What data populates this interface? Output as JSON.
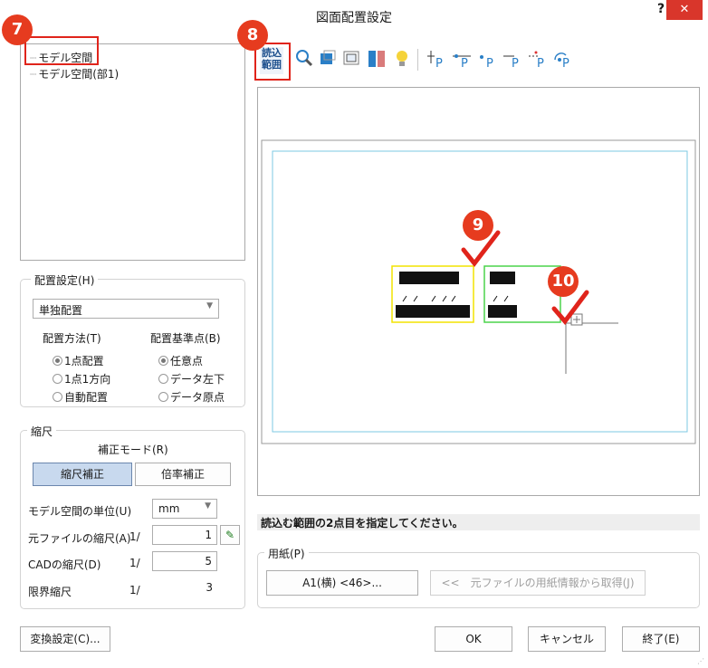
{
  "window": {
    "title": "図面配置設定",
    "help": "?",
    "close": "✕"
  },
  "tree": {
    "items": [
      "モデル空間",
      "モデル空間(部1)"
    ]
  },
  "placement": {
    "group_label": "配置設定(H)",
    "mode_value": "単独配置",
    "method_label": "配置方法(T)",
    "method_options": [
      "1点配置",
      "1点1方向",
      "自動配置"
    ],
    "method_selected": 0,
    "base_label": "配置基準点(B)",
    "base_options": [
      "任意点",
      "データ左下",
      "データ原点"
    ],
    "base_selected": 0
  },
  "scale": {
    "group_label": "縮尺",
    "mode_label": "補正モード(R)",
    "btn_scale": "縮尺補正",
    "btn_ratio": "倍率補正",
    "unit_label": "モデル空間の単位(U)",
    "unit_value": "mm",
    "src_label": "元ファイルの縮尺(A)",
    "src_prefix": "1/",
    "src_value": "1",
    "cad_label": "CADの縮尺(D)",
    "cad_prefix": "1/",
    "cad_value": "5",
    "limit_label": "限界縮尺",
    "limit_prefix": "1/",
    "limit_value": "3"
  },
  "toolbar": {
    "icons": [
      "read-range-icon",
      "zoom-icon",
      "move-icon",
      "scale-icon",
      "convert-icon",
      "bulb-icon",
      "point-tl-icon",
      "point-tc-icon",
      "point-tr-icon",
      "point-bl-icon",
      "point-bc-icon",
      "point-origin-icon"
    ],
    "read_label": "読込",
    "read_label2": "範囲"
  },
  "status": {
    "text": "読込む範囲の2点目を指定してください。"
  },
  "paper": {
    "group_label": "用紙(P)",
    "size_button": "A1(横) <46>...",
    "fetch_button": "<<　元ファイルの用紙情報から取得(J)"
  },
  "footer": {
    "convert_button": "変換設定(C)...",
    "ok": "OK",
    "cancel": "キャンセル",
    "finish": "終了(E)"
  },
  "markers": [
    "7",
    "8",
    "9",
    "10"
  ],
  "colors": {
    "accent_red": "#e63b1f",
    "frame_yellow": "#f2e300",
    "frame_green": "#4bd34b",
    "paper_border": "#7ec8e3"
  }
}
